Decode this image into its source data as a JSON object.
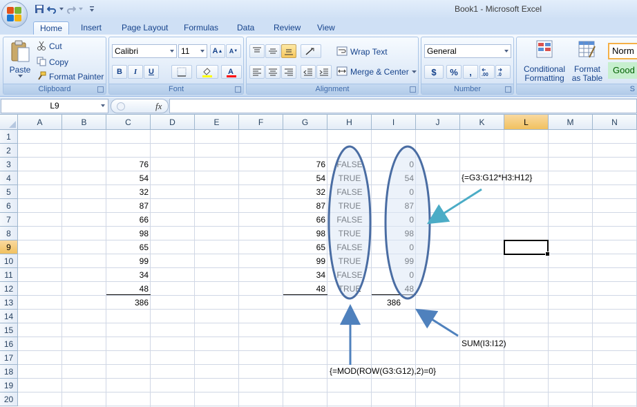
{
  "window": {
    "title": "Book1 - Microsoft Excel"
  },
  "tabs": [
    "Home",
    "Insert",
    "Page Layout",
    "Formulas",
    "Data",
    "Review",
    "View"
  ],
  "ribbon": {
    "clipboard": {
      "paste": "Paste",
      "cut": "Cut",
      "copy": "Copy",
      "format_painter": "Format Painter",
      "label": "Clipboard"
    },
    "font": {
      "name": "Calibri",
      "size": "11",
      "bold": "B",
      "italic": "I",
      "underline": "U",
      "label": "Font"
    },
    "alignment": {
      "wrap_text": "Wrap Text",
      "merge_center": "Merge & Center",
      "label": "Alignment"
    },
    "number": {
      "format": "General",
      "currency": "$",
      "percent": "%",
      "comma": ",",
      "label": "Number"
    },
    "styles": {
      "conditional_1": "Conditional",
      "conditional_2": "Formatting",
      "table_1": "Format",
      "table_2": "as Table",
      "normal": "Norm",
      "good": "Good",
      "label": "S"
    }
  },
  "formula_bar": {
    "name_box": "L9",
    "fx": "fx",
    "formula": ""
  },
  "columns": [
    "A",
    "B",
    "C",
    "D",
    "E",
    "F",
    "G",
    "H",
    "I",
    "J",
    "K",
    "L",
    "M",
    "N"
  ],
  "rows": [
    "1",
    "2",
    "3",
    "4",
    "5",
    "6",
    "7",
    "8",
    "9",
    "10",
    "11",
    "12",
    "13",
    "14",
    "15",
    "16",
    "17",
    "18",
    "19",
    "20"
  ],
  "cells": {
    "C": [
      "76",
      "54",
      "32",
      "87",
      "66",
      "98",
      "65",
      "99",
      "34",
      "48"
    ],
    "C13": "386",
    "G": [
      "76",
      "54",
      "32",
      "87",
      "66",
      "98",
      "65",
      "99",
      "34",
      "48"
    ],
    "H": [
      "FALSE",
      "TRUE",
      "FALSE",
      "TRUE",
      "FALSE",
      "TRUE",
      "FALSE",
      "TRUE",
      "FALSE",
      "TRUE"
    ],
    "I": [
      "0",
      "54",
      "0",
      "87",
      "0",
      "98",
      "0",
      "99",
      "0",
      "48"
    ],
    "I13": "386"
  },
  "annotations": {
    "multiply": "{=G3:G12*H3:H12}",
    "sum": "SUM(I3:I12)",
    "mod": "{=MOD(ROW(G3:G12),2)=0}"
  },
  "colors": {
    "accent": "#15428b",
    "oval": "#4a6da3",
    "arrow_teal": "#4bacc6",
    "arrow_blue": "#4f81bd",
    "highlight": "#dde8f5"
  }
}
